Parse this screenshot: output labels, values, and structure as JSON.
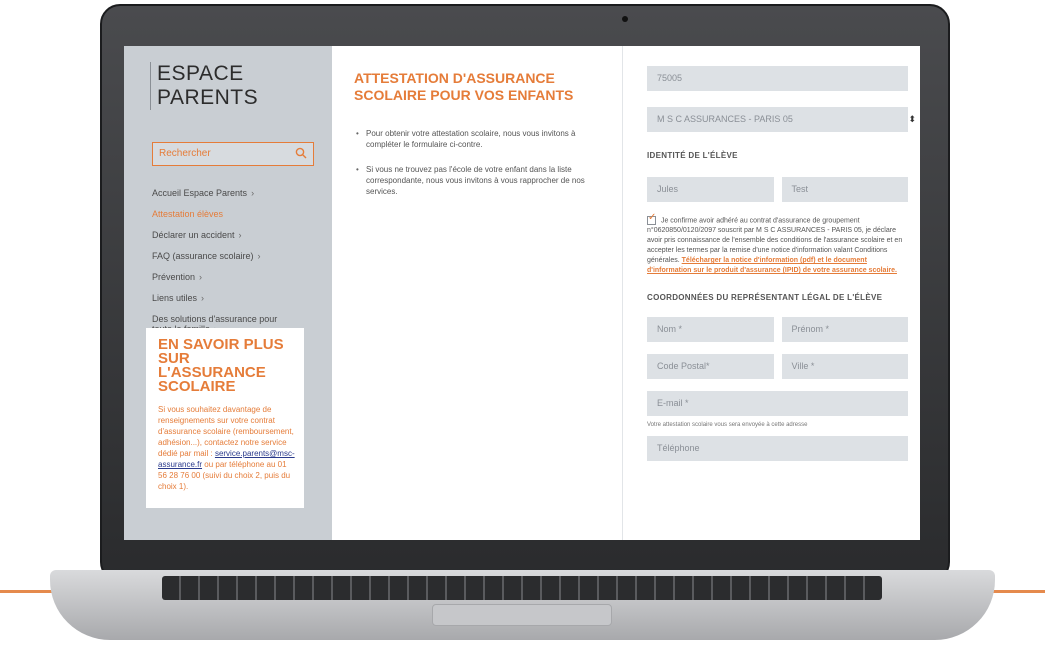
{
  "sidebar": {
    "brand": "ESPACE PARENTS",
    "search_placeholder": "Rechercher",
    "nav": [
      {
        "label": "Accueil Espace Parents"
      },
      {
        "label": "Attestation élèves"
      },
      {
        "label": "Déclarer un accident"
      },
      {
        "label": "FAQ (assurance scolaire)"
      },
      {
        "label": "Prévention"
      },
      {
        "label": "Liens utiles"
      },
      {
        "label": "Des solutions d'assurance pour toute la famille"
      }
    ],
    "promo": {
      "title": "EN SAVOIR PLUS SUR L'ASSURANCE SCOLAIRE",
      "text_before": "Si vous souhaitez davantage de renseignements sur votre contrat d'assurance scolaire (remboursement, adhésion...), contactez notre service dédié par mail :",
      "link": "service.parents@msc-assurance.fr",
      "text_after": "ou par téléphone au 01 56 28 76 00 (suivi du choix 2, puis du choix 1)."
    }
  },
  "main": {
    "title": "ATTESTATION D'ASSURANCE SCOLAIRE POUR VOS ENFANTS",
    "bullets": [
      "Pour obtenir votre attestation scolaire, nous vous invitons à compléter le formulaire ci-contre.",
      "Si vous ne trouvez pas l'école de votre enfant dans la liste correspondante, nous vous invitons à vous rapprocher de nos services."
    ]
  },
  "form": {
    "postal_prefill": "75005",
    "insurer_value": "M S C ASSURANCES - PARIS 05",
    "student_section": "IDENTITÉ DE L'ÉLÈVE",
    "student_first_name": "Jules",
    "student_last_name": "Test",
    "consent_before": "Je confirme avoir adhéré au contrat d'assurance de groupement n°0620850/0120/2097 souscrit par M S C ASSURANCES - PARIS 05, je déclare avoir pris connaissance de l'ensemble des conditions de l'assurance scolaire et en accepter les termes par la remise d'une notice d'information valant Conditions générales.",
    "consent_link": "Télécharger la notice d'information (pdf) et le document d'information sur le produit d'assurance (IPID) de votre assurance scolaire.",
    "guardian_section": "COORDONNÉES DU REPRÉSENTANT LÉGAL DE L'ÉLÈVE",
    "nom_placeholder": "Nom *",
    "prenom_placeholder": "Prénom *",
    "cp_placeholder": "Code Postal*",
    "ville_placeholder": "Ville *",
    "email_placeholder": "E-mail *",
    "email_note": "Votre attestation scolaire vous sera envoyée à cette adresse",
    "tel_placeholder": "Téléphone"
  }
}
